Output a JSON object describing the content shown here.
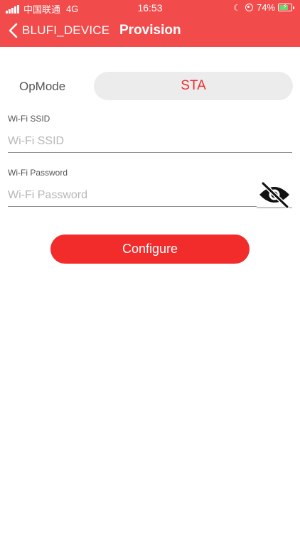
{
  "status_bar": {
    "carrier": "中国联通",
    "network": "4G",
    "time": "16:53",
    "battery_percent": "74%",
    "battery_level": 0.74,
    "icons": [
      "signal-icon",
      "moon-icon",
      "orientation-lock-icon",
      "battery-icon"
    ]
  },
  "nav": {
    "back_label": "BLUFI_DEVICE",
    "title": "Provision"
  },
  "form": {
    "opmode_label": "OpMode",
    "opmode_value": "STA",
    "ssid_label": "Wi-Fi SSID",
    "ssid_placeholder": "Wi-Fi SSID",
    "ssid_value": "",
    "password_label": "Wi-Fi Password",
    "password_placeholder": "Wi-Fi Password",
    "password_value": "",
    "password_visibility_icon": "eye-off-icon"
  },
  "actions": {
    "configure_label": "Configure"
  },
  "colors": {
    "header_bg": "#f24b4b",
    "accent": "#f22b2b",
    "select_bg": "#ececec",
    "battery_fill": "#6dd36d"
  }
}
